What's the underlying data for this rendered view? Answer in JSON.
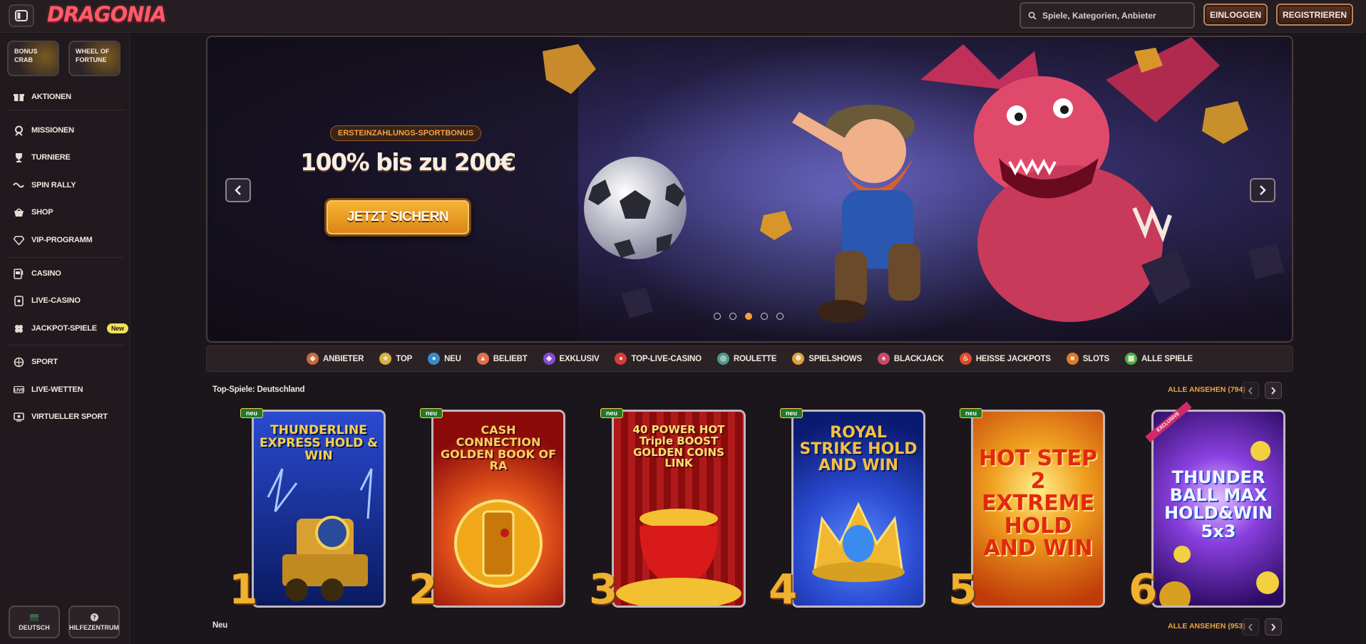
{
  "header": {
    "logo": "DRAGONIA",
    "search_placeholder": "Spiele, Kategorien, Anbieter",
    "login_label": "EINLOGGEN",
    "register_label": "REGISTRIEREN"
  },
  "sidebar": {
    "promos": [
      {
        "label": "BONUS CRAB"
      },
      {
        "label": "WHEEL OF FORTUNE"
      }
    ],
    "items": [
      {
        "label": "AKTIONEN",
        "icon": "gift-icon"
      },
      {
        "label": "MISSIONEN",
        "icon": "mission-icon"
      },
      {
        "label": "TURNIERE",
        "icon": "trophy-icon"
      },
      {
        "label": "SPIN RALLY",
        "icon": "rally-icon"
      },
      {
        "label": "SHOP",
        "icon": "basket-icon"
      },
      {
        "label": "VIP-PROGRAMM",
        "icon": "diamond-icon"
      },
      {
        "label": "CASINO",
        "icon": "slot-machine-icon"
      },
      {
        "label": "LIVE-CASINO",
        "icon": "cards-icon"
      },
      {
        "label": "JACKPOT-SPIELE",
        "icon": "clover-icon",
        "badge": "New"
      },
      {
        "label": "SPORT",
        "icon": "ball-icon"
      },
      {
        "label": "LIVE-WETTEN",
        "icon": "live-icon"
      },
      {
        "label": "VIRTUELLER SPORT",
        "icon": "virtual-sport-icon"
      }
    ],
    "footer": {
      "language": "DEUTSCH",
      "help": "HILFEZENTRUM"
    }
  },
  "hero": {
    "badge": "ERSTEINZAHLUNGS-SPORTBONUS",
    "title": "100% bis zu 200€",
    "cta": "JETZT SICHERN",
    "slides": 5,
    "active_slide": 3
  },
  "categories": [
    {
      "label": "ANBIETER",
      "color": "#c86a3a"
    },
    {
      "label": "TOP",
      "color": "#d8b040"
    },
    {
      "label": "NEU",
      "color": "#3a8ac8"
    },
    {
      "label": "BELIEBT",
      "color": "#e0704a"
    },
    {
      "label": "EXKLUSIV",
      "color": "#8a4ad8"
    },
    {
      "label": "TOP-LIVE-CASINO",
      "color": "#d83a3a"
    },
    {
      "label": "ROULETTE",
      "color": "#4a9a8a"
    },
    {
      "label": "SPIELSHOWS",
      "color": "#e0a03a"
    },
    {
      "label": "BLACKJACK",
      "color": "#c84a6a"
    },
    {
      "label": "HEISSE JACKPOTS",
      "color": "#e04a2a"
    },
    {
      "label": "SLOTS",
      "color": "#e07a2a"
    },
    {
      "label": "ALLE SPIELE",
      "color": "#4ab04a"
    }
  ],
  "top_games": {
    "title": "Top-Spiele: Deutschland",
    "view_all": "ALLE ANSEHEN (794)",
    "games": [
      {
        "rank": "1",
        "name": "THUNDERLINE EXPRESS HOLD & WIN",
        "badge": "neu",
        "bg1": "#2a4ad0",
        "bg2": "#0a1a60",
        "color": "#f6d04a"
      },
      {
        "rank": "2",
        "name": "CASH CONNECTION GOLDEN BOOK OF RA",
        "badge": "neu",
        "bg1": "#c82a1a",
        "bg2": "#4a0a0a",
        "color": "#f8d060"
      },
      {
        "rank": "3",
        "name": "40 POWER HOT Triple BOOST GOLDEN COINS LINK",
        "badge": "neu",
        "bg1": "#b01a1a",
        "bg2": "#5a0808",
        "color": "#f8e070"
      },
      {
        "rank": "4",
        "name": "ROYAL STRIKE HOLD AND WIN",
        "badge": "neu",
        "bg1": "#2a5ae0",
        "bg2": "#0a1a70",
        "color": "#f2c040"
      },
      {
        "rank": "5",
        "name": "HOT STEP 2 EXTREME HOLD AND WIN",
        "badge": "neu",
        "bg1": "#f0a020",
        "bg2": "#c03a08",
        "color": "#e02a10"
      },
      {
        "rank": "6",
        "name": "THUNDER BALL MAX HOLD&WIN 5x3",
        "badge": "EXCLUSIVE",
        "bg1": "#8a40e0",
        "bg2": "#2a0a60",
        "color": "#f2f6ff"
      }
    ]
  },
  "new_section": {
    "title": "Neu",
    "view_all": "ALLE ANSEHEN (953)"
  }
}
